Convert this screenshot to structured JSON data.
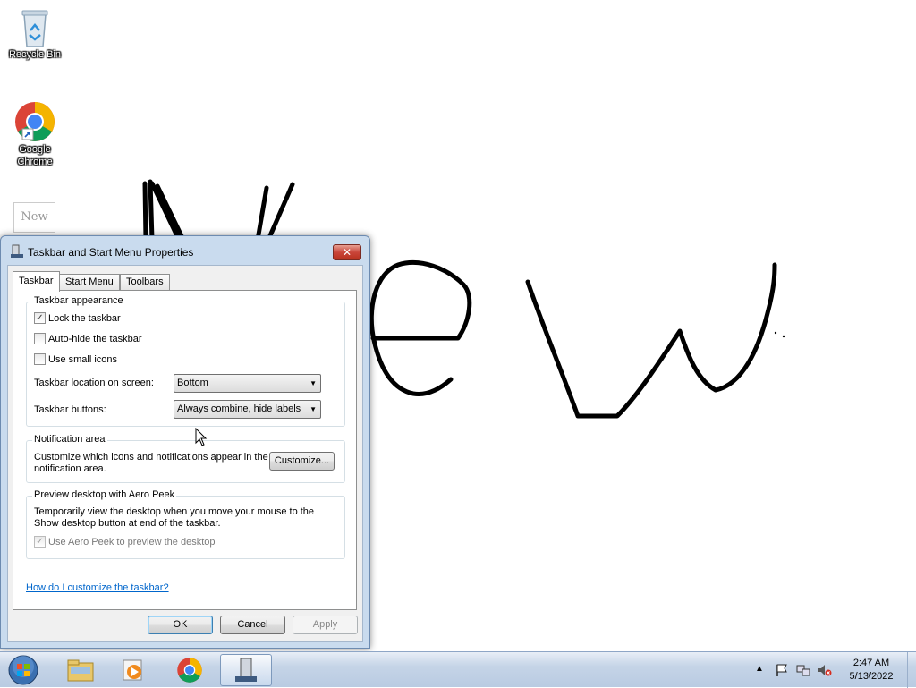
{
  "desktop": {
    "icons": [
      {
        "label": "Recycle Bin",
        "icon": "recycle-bin-icon"
      },
      {
        "label": "Google Chrome",
        "icon": "chrome-icon"
      }
    ],
    "thumbnail_text": "New",
    "drawing_text": "New"
  },
  "dialog": {
    "title": "Taskbar and Start Menu Properties",
    "close_label": "✕",
    "tabs": [
      {
        "label": "Taskbar",
        "active": true
      },
      {
        "label": "Start Menu",
        "active": false
      },
      {
        "label": "Toolbars",
        "active": false
      }
    ],
    "appearance": {
      "title": "Taskbar appearance",
      "lock_label": "Lock the taskbar",
      "lock_checked": true,
      "autohide_label": "Auto-hide the taskbar",
      "autohide_checked": false,
      "small_icons_label": "Use small icons",
      "small_icons_checked": false,
      "location_label": "Taskbar location on screen:",
      "location_value": "Bottom",
      "buttons_label": "Taskbar buttons:",
      "buttons_value": "Always combine, hide labels"
    },
    "notification": {
      "title": "Notification area",
      "description": "Customize which icons and notifications appear in the notification area.",
      "customize_label": "Customize..."
    },
    "aero_peek": {
      "title": "Preview desktop with Aero Peek",
      "description": "Temporarily view the desktop when you move your mouse to the Show desktop button at end of the taskbar.",
      "checkbox_label": "Use Aero Peek to preview the desktop",
      "checked": true
    },
    "help_link": "How do I customize the taskbar?",
    "buttons": {
      "ok": "OK",
      "cancel": "Cancel",
      "apply": "Apply"
    }
  },
  "taskbar": {
    "items": [
      {
        "name": "explorer",
        "icon": "folder-icon"
      },
      {
        "name": "media-player",
        "icon": "media-player-icon"
      },
      {
        "name": "chrome",
        "icon": "chrome-icon"
      },
      {
        "name": "taskbar-properties",
        "icon": "taskbar-properties-icon",
        "active": true
      }
    ],
    "clock_time": "2:47 AM",
    "clock_date": "5/13/2022"
  }
}
